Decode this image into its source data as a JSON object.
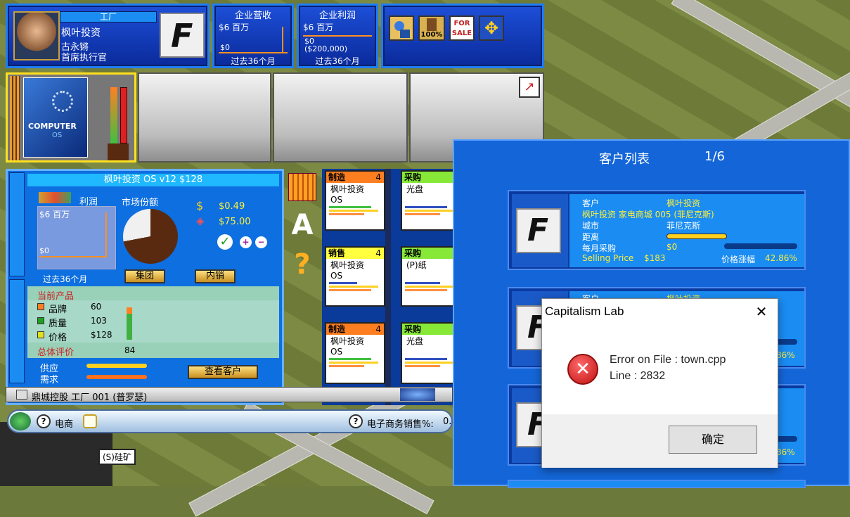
{
  "header": {
    "title_tab": "工厂",
    "company": "枫叶投资",
    "person": "古永锵",
    "role": "首席执行官"
  },
  "revenue": {
    "title": "企业营收",
    "top": "$6 百万",
    "zero": "$0",
    "footer": "过去36个月"
  },
  "profit": {
    "title": "企业利润",
    "top": "$6 百万",
    "zero": "$0",
    "low": "($200,000)",
    "footer": "过去36个月"
  },
  "toolbar": {
    "percent": "100%",
    "forsale": "FOR SALE"
  },
  "product": {
    "box_text1": "COMPUTER",
    "box_text2": "OS",
    "title": "枫叶投资  OS v12   $128",
    "profit_label": "利润",
    "profit_top": "$6 百万",
    "profit_zero": "$0",
    "profit_footer": "过去36个月",
    "share_label": "市场份额",
    "cost": "$0.49",
    "price": "$75.00",
    "btn_group": "集团",
    "btn_domestic": "内销",
    "current_product": "当前产品",
    "brand_label": "品牌",
    "brand_val": "60",
    "quality_label": "质量",
    "quality_val": "103",
    "price_label": "价格",
    "price_val": "$128",
    "overall_label": "总体评价",
    "overall_val": "84",
    "supply": "供应",
    "demand": "需求",
    "btn_customers": "查看客户"
  },
  "nodes": [
    {
      "title": "制造",
      "num": "4",
      "l1": "枫叶投资",
      "l2": "OS",
      "color": "#ff7f20"
    },
    {
      "title": "采购",
      "num": "",
      "l1": "光盘",
      "l2": "",
      "color": "#88e838"
    },
    {
      "title": "销售",
      "num": "4",
      "l1": "枫叶投资",
      "l2": "OS",
      "color": "#ffff40"
    },
    {
      "title": "采购",
      "num": "",
      "l1": "(P)纸",
      "l2": "",
      "color": "#88e838"
    },
    {
      "title": "制造",
      "num": "4",
      "l1": "枫叶投资",
      "l2": "OS",
      "color": "#ff7f20"
    },
    {
      "title": "采购",
      "num": "",
      "l1": "光盘",
      "l2": "",
      "color": "#88e838"
    }
  ],
  "statusbar": {
    "text": "鼎城控股  工厂  001  (普罗瑟)"
  },
  "bottombar": {
    "ecommerce": "电商",
    "ecom_sales": "电子商务销售%:",
    "ecom_val": "0.0"
  },
  "map_label": "(S)硅矿",
  "customers": {
    "title": "客户列表",
    "page": "1/6",
    "card": {
      "customer_label": "客户",
      "customer_val": "枫叶投资",
      "store": "枫叶投资  家电商城  005  (菲尼克斯)",
      "city_label": "城市",
      "city_val": "菲尼克斯",
      "distance_label": "距离",
      "monthly_label": "每月采购",
      "monthly_val": "$0",
      "selling_label": "Selling Price",
      "selling_val": "$183",
      "rise_label": "价格涨幅",
      "rise_val": "42.86%"
    },
    "card2": {
      "customer_label": "客户",
      "customer_val": "枫叶投资",
      "rise_val": "86%"
    },
    "card3": {
      "rise_val": "86%"
    }
  },
  "dialog": {
    "title": "Capitalism Lab",
    "line1": "Error on File : town.cpp",
    "line2": "Line : 2832",
    "ok": "确定"
  }
}
